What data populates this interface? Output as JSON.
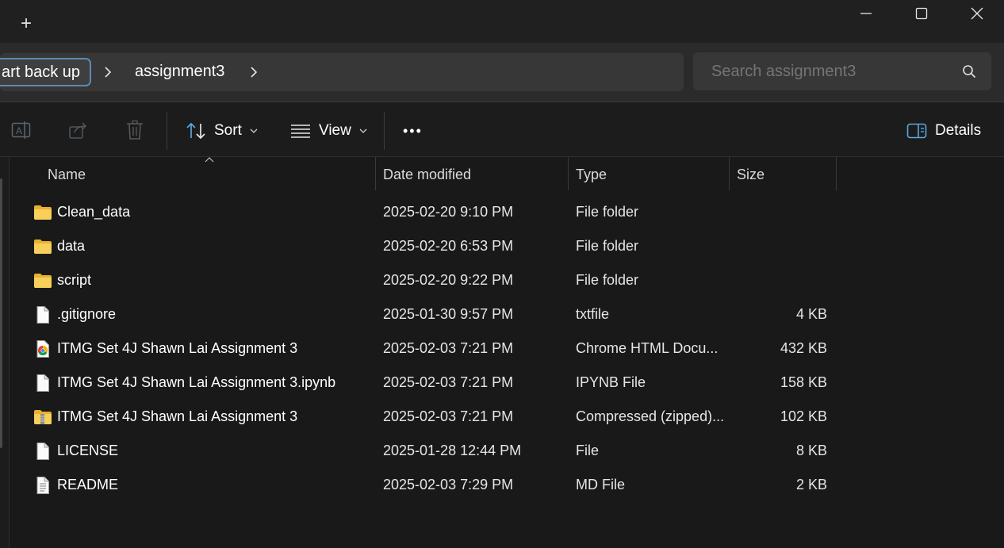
{
  "titlebar": {
    "new_tab_label": "+",
    "minimize_icon": "minimize-icon",
    "maximize_icon": "maximize-icon",
    "close_icon": "close-icon"
  },
  "address": {
    "crumb_partial": "art back up",
    "crumb_current": "assignment3"
  },
  "search": {
    "placeholder": "Search assignment3"
  },
  "toolbar": {
    "sort_label": "Sort",
    "view_label": "View",
    "more_label": "•••",
    "details_label": "Details"
  },
  "columns": {
    "name": "Name",
    "date": "Date modified",
    "type": "Type",
    "size": "Size"
  },
  "files": [
    {
      "name": "Clean_data",
      "date": "2025-02-20 9:10 PM",
      "type": "File folder",
      "size": "",
      "icon": "folder-icon"
    },
    {
      "name": "data",
      "date": "2025-02-20 6:53 PM",
      "type": "File folder",
      "size": "",
      "icon": "folder-icon"
    },
    {
      "name": "script",
      "date": "2025-02-20 9:22 PM",
      "type": "File folder",
      "size": "",
      "icon": "folder-icon"
    },
    {
      "name": ".gitignore",
      "date": "2025-01-30 9:57 PM",
      "type": "txtfile",
      "size": "4 KB",
      "icon": "file-icon"
    },
    {
      "name": "ITMG Set 4J Shawn Lai Assignment 3",
      "date": "2025-02-03 7:21 PM",
      "type": "Chrome HTML Docu...",
      "size": "432 KB",
      "icon": "chrome-html-icon"
    },
    {
      "name": "ITMG Set 4J Shawn Lai Assignment 3.ipynb",
      "date": "2025-02-03 7:21 PM",
      "type": "IPYNB File",
      "size": "158 KB",
      "icon": "file-icon"
    },
    {
      "name": "ITMG Set 4J Shawn Lai Assignment 3",
      "date": "2025-02-03 7:21 PM",
      "type": "Compressed (zipped)...",
      "size": "102 KB",
      "icon": "zip-folder-icon"
    },
    {
      "name": "LICENSE",
      "date": "2025-01-28 12:44 PM",
      "type": "File",
      "size": "8 KB",
      "icon": "file-icon"
    },
    {
      "name": "README",
      "date": "2025-02-03 7:29 PM",
      "type": "MD File",
      "size": "2 KB",
      "icon": "text-file-icon"
    }
  ],
  "colors": {
    "background": "#191919",
    "titlebar": "#202020",
    "address_row": "#2b2b2b",
    "field": "#373737",
    "accent_border": "#5d8ab0",
    "folder": "#f4c542",
    "icon_accent": "#4aa3df"
  }
}
